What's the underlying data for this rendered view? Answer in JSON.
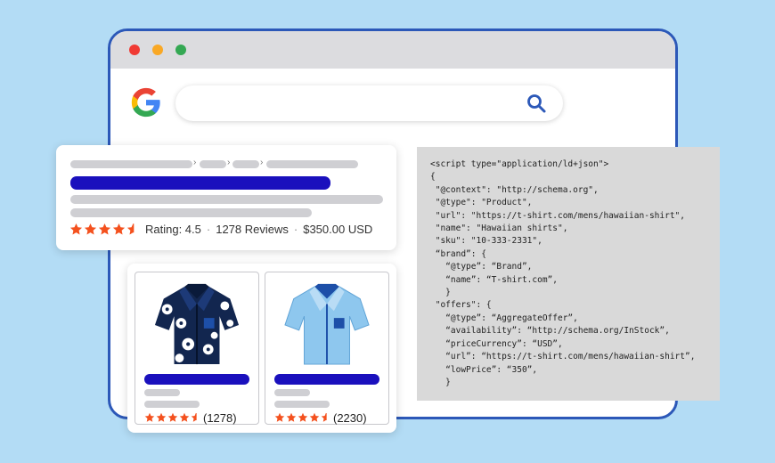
{
  "browser": {
    "window_controls": [
      "close",
      "minimize",
      "maximize"
    ],
    "logo_icon": "google-g-icon",
    "search": {
      "value": "",
      "icon": "magnifier-icon"
    }
  },
  "search_result": {
    "rating_stars": 4.5,
    "rating_text": "Rating: 4.5",
    "reviews": "1278 Reviews",
    "price": "$350.00 USD",
    "separator": "·",
    "breadcrumb_separator": "›"
  },
  "products": [
    {
      "image_icon": "hawaiian-shirt-icon",
      "rating_stars": 4.5,
      "count": "(1278)"
    },
    {
      "image_icon": "plain-shirt-icon",
      "rating_stars": 4.5,
      "count": "(2230)"
    }
  ],
  "code": {
    "lines": [
      "<script type=\"application/ld+json\">",
      "{",
      " \"@context\": \"http://schema.org\",",
      " \"@type\": \"Product\",",
      " \"url\": \"https://t-shirt.com/mens/hawaiian-shirt\",",
      " \"name\": \"Hawaiian shirts\",",
      " \"sku\": \"10-333-2331\",",
      " “brand”: {",
      "   “@type”: “Brand”,",
      "   “name”: “T-shirt.com”,",
      "   }",
      " \"offers\": {",
      "   “@type”: “AggregateOffer”,",
      "   “availability”: “http://schema.org/InStock”,",
      "   “priceCurrency”: “USD”,",
      "   “url”: “https://t-shirt.com/mens/hawaiian-shirt”,",
      "   “lowPrice”: “350”,",
      "   }"
    ]
  },
  "colors": {
    "background": "#b3dcf5",
    "browser_border": "#2c58b8",
    "link_blue": "#1a10bd",
    "star": "#f4511e",
    "placeholder_gray": "#cfcfd3",
    "code_bg": "#d9d9d9"
  }
}
